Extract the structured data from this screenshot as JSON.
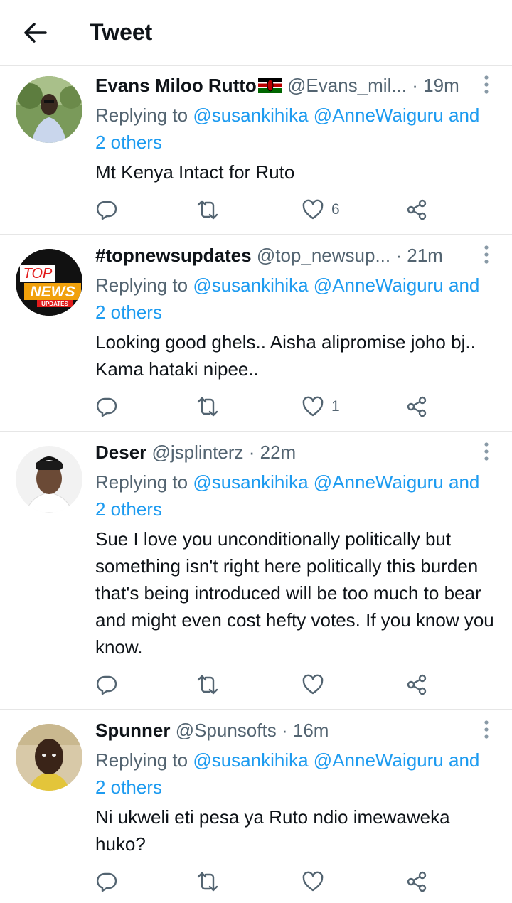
{
  "header": {
    "title": "Tweet"
  },
  "tweets": [
    {
      "name": "Evans Miloo Rutto",
      "handle": "@Evans_mil...",
      "sep": "·",
      "time": "19m",
      "replying_prefix": "Replying to",
      "mention1": "@susankihika",
      "mention2": "@AnneWaiguru",
      "others": "and 2 others",
      "text": "Mt Kenya Intact for Ruto",
      "like_count": "6"
    },
    {
      "name": "#topnewsupdates",
      "handle": "@top_newsup...",
      "sep": "·",
      "time": "21m",
      "replying_prefix": "Replying to",
      "mention1": "@susankihika",
      "mention2": "@AnneWaiguru",
      "others": "and 2 others",
      "text": "Looking good ghels.. Aisha alipromise joho bj.. Kama hataki nipee..",
      "like_count": "1",
      "avatar_text_top": "TOP",
      "avatar_text_main": "NEWS",
      "avatar_text_sub": "UPDATES"
    },
    {
      "name": "Deser",
      "handle": "@jsplinterz",
      "sep": "·",
      "time": "22m",
      "replying_prefix": "Replying to",
      "mention1": "@susankihika",
      "mention2": "@AnneWaiguru",
      "others": "and 2 others",
      "text": "Sue I love you unconditionally politically but something isn't right here politically this burden that's being introduced will be too much to bear and might even cost hefty votes. If you know you know.",
      "like_count": ""
    },
    {
      "name": "Spunner",
      "handle": "@Spunsofts",
      "sep": "·",
      "time": "16m",
      "replying_prefix": "Replying to",
      "mention1": "@susankihika",
      "mention2": "@AnneWaiguru",
      "others": "and 2 others",
      "text": "Ni ukweli eti pesa ya Ruto ndio imewaweka huko?",
      "like_count": ""
    }
  ],
  "icons": {
    "back": "arrow-left-icon",
    "reply": "reply-icon",
    "retweet": "retweet-icon",
    "like": "heart-icon",
    "share": "share-icon",
    "more": "more-vertical-icon",
    "flag": "kenya-flag-icon"
  },
  "colors": {
    "accent": "#1d9bf0",
    "text": "#0f1419",
    "muted": "#536471",
    "divider": "#e6e6e6"
  }
}
